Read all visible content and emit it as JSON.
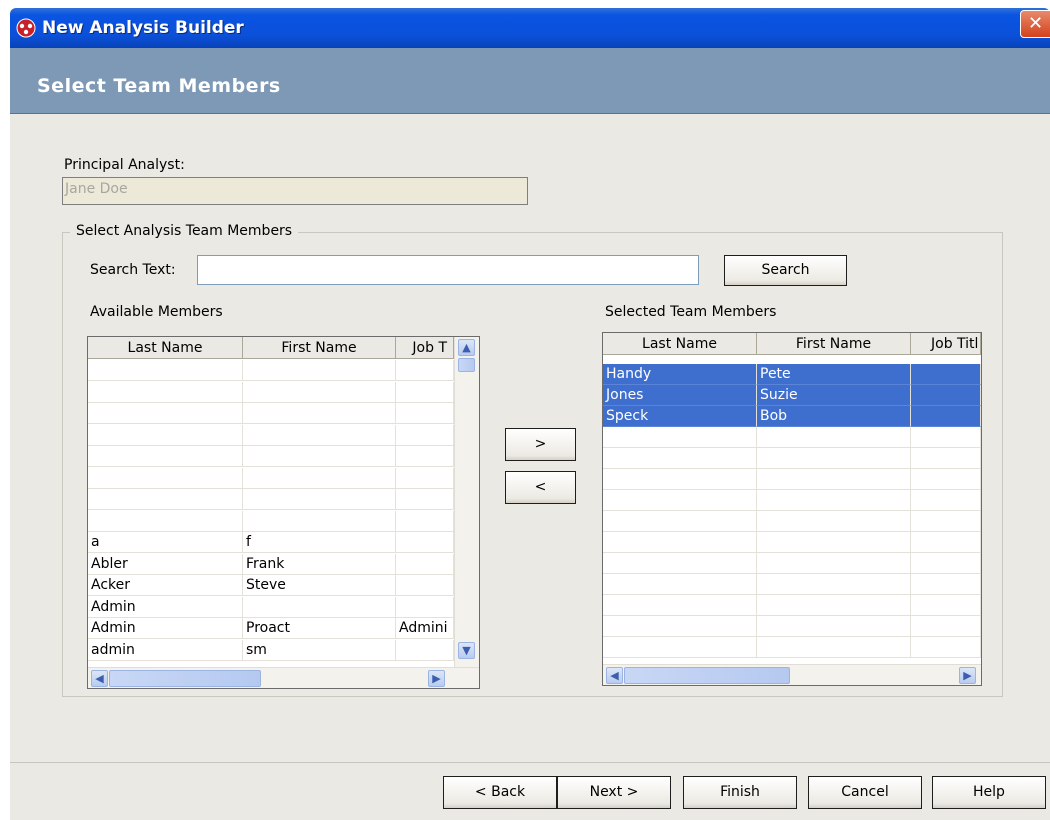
{
  "window": {
    "title": "New Analysis Builder",
    "close_glyph": "✕"
  },
  "header": {
    "title": "Select Team Members"
  },
  "principal": {
    "label": "Principal Analyst:",
    "value": "Jane Doe"
  },
  "group": {
    "caption": "Select Analysis Team Members"
  },
  "search": {
    "label": "Search Text:",
    "value": "",
    "button": "Search"
  },
  "available": {
    "label": "Available Members",
    "columns": [
      "Last Name",
      "First Name",
      "Job T"
    ],
    "rows": [
      [
        "",
        "",
        ""
      ],
      [
        "",
        "",
        ""
      ],
      [
        "",
        "",
        ""
      ],
      [
        "",
        "",
        ""
      ],
      [
        "",
        "",
        ""
      ],
      [
        "",
        "",
        ""
      ],
      [
        "",
        "",
        ""
      ],
      [
        "",
        "",
        ""
      ],
      [
        "a",
        "f",
        ""
      ],
      [
        "Abler",
        "Frank",
        ""
      ],
      [
        "Acker",
        "Steve",
        ""
      ],
      [
        "Admin",
        "",
        ""
      ],
      [
        "Admin",
        "Proact",
        "Admini"
      ],
      [
        "admin",
        "sm",
        ""
      ]
    ]
  },
  "transfer": {
    "add": ">",
    "remove": "<"
  },
  "selected": {
    "label": "Selected Team Members",
    "columns": [
      "Last Name",
      "First Name",
      "Job Titl"
    ],
    "rows": [
      [
        "Handy",
        "Pete",
        ""
      ],
      [
        "Jones",
        "Suzie",
        ""
      ],
      [
        "Speck",
        "Bob",
        ""
      ]
    ]
  },
  "footer": {
    "back": "< Back",
    "next": "Next >",
    "finish": "Finish",
    "cancel": "Cancel",
    "help": "Help"
  },
  "colors": {
    "title_bar": "#0a54e3",
    "header": "#7e99b5",
    "selection": "#3f6fce",
    "panel": "#ebe9e4"
  }
}
